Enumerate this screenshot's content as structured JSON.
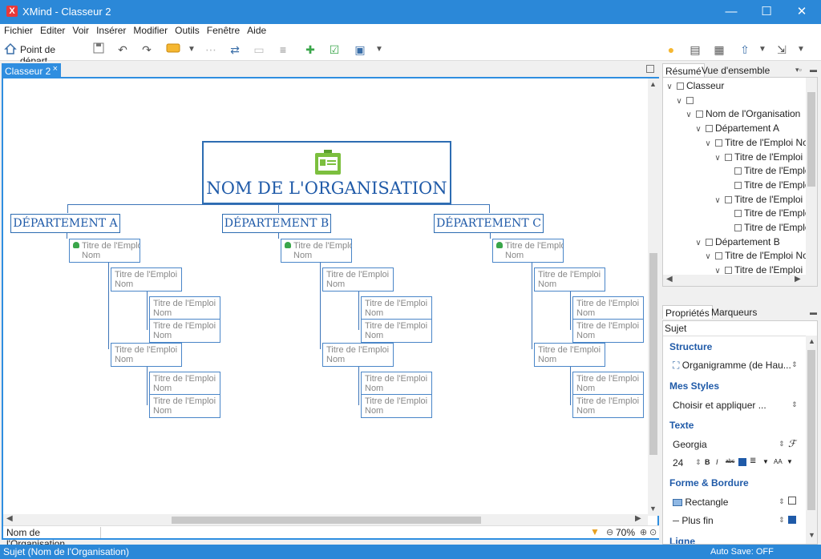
{
  "window": {
    "title": "XMind - Classeur  2",
    "logo": "X",
    "minimize": "—",
    "maximize": "☐",
    "close": "✕"
  },
  "menu": [
    "Fichier",
    "Editer",
    "Voir",
    "Insérer",
    "Modifier",
    "Outils",
    "Fenêtre",
    "Aide"
  ],
  "toolbar": {
    "home_label": "Point de départ"
  },
  "editor": {
    "tab_label": "Classeur  2",
    "tab_close": "×"
  },
  "map": {
    "root": "NOM DE L'ORGANISATION",
    "departments": [
      "DÉPARTEMENT A",
      "DÉPARTEMENT B",
      "DÉPARTEMENT C"
    ],
    "job_line1": "Titre de l'Emploi",
    "job_line2": "Nom"
  },
  "statusrow": {
    "topic_name": "Nom de l'Organisation",
    "zoom": "70%"
  },
  "panels": {
    "tabs": [
      "Résumé",
      "Vue d'ensemble"
    ],
    "tree": [
      {
        "indent": 0,
        "label": "Classeur"
      },
      {
        "indent": 1,
        "label": ""
      },
      {
        "indent": 2,
        "label": "Nom de l'Organisation"
      },
      {
        "indent": 3,
        "label": "Département A"
      },
      {
        "indent": 4,
        "label": "Titre de l'Emploi No"
      },
      {
        "indent": 5,
        "label": "Titre de l'Emploi N"
      },
      {
        "indent": 6,
        "label": "Titre de l'Emplo"
      },
      {
        "indent": 6,
        "label": "Titre de l'Emplo"
      },
      {
        "indent": 5,
        "label": "Titre de l'Emploi N"
      },
      {
        "indent": 6,
        "label": "Titre de l'Emplo"
      },
      {
        "indent": 6,
        "label": "Titre de l'Emplo"
      },
      {
        "indent": 3,
        "label": "Département B"
      },
      {
        "indent": 4,
        "label": "Titre de l'Emploi No"
      },
      {
        "indent": 5,
        "label": "Titre de l'Emploi N"
      },
      {
        "indent": 6,
        "label": "Titre de l'Emplo"
      }
    ],
    "props_tabs": [
      "Propriétés",
      "Marqueurs"
    ],
    "props": {
      "subject": "Sujet",
      "structure_title": "Structure",
      "structure_value": "Organigramme (de Hau...",
      "styles_title": "Mes Styles",
      "styles_value": "Choisir et appliquer ...",
      "text_title": "Texte",
      "font": "Georgia",
      "size": "24",
      "shape_title": "Forme & Bordure",
      "shape_value": "Rectangle",
      "border_value": "Plus fin",
      "line_title": "Ligne"
    }
  },
  "statusbar": {
    "left": "Sujet (Nom de l'Organisation)",
    "right": "Auto Save: OFF"
  },
  "colors": {
    "accent": "#2b88d8",
    "node_border": "#2d6cb2",
    "node_text": "#1f5aa8"
  }
}
